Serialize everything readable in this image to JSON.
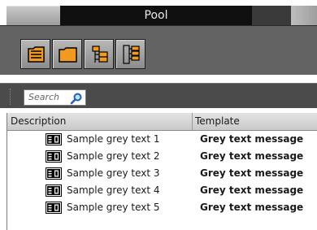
{
  "window": {
    "title": "Pool"
  },
  "toolbar": {
    "buttons": [
      {
        "icon": "document-lines-icon"
      },
      {
        "icon": "folder-icon"
      },
      {
        "icon": "tree-branch-icon"
      },
      {
        "icon": "tree-list-icon"
      }
    ]
  },
  "search": {
    "placeholder": "Search"
  },
  "grid": {
    "columns": [
      "Description",
      "Template"
    ],
    "rows": [
      {
        "description": "Sample grey text 1",
        "template": "Grey text message"
      },
      {
        "description": "Sample grey text 2",
        "template": "Grey text message"
      },
      {
        "description": "Sample grey text 3",
        "template": "Grey text message"
      },
      {
        "description": "Sample grey text 4",
        "template": "Grey text message"
      },
      {
        "description": "Sample grey text 5",
        "template": "Grey text message"
      }
    ]
  },
  "colors": {
    "accent_orange": "#f29a1f",
    "toolbar_bg": "#636363",
    "title_bg": "#101010"
  }
}
